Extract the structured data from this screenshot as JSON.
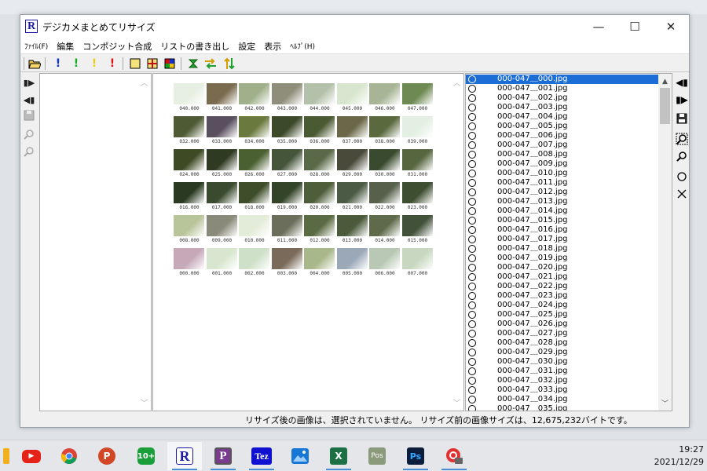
{
  "window": {
    "title": "デジカメまとめてリサイズ",
    "logo": "R"
  },
  "menu": {
    "file": "ﾌｧｲﾙ(F)",
    "edit": "編集",
    "composite": "コンポジット合成",
    "list_export": "リストの書き出し",
    "settings": "設定",
    "view": "表示",
    "help": "ﾍﾙﾌﾟ(H)"
  },
  "thumbnails": {
    "rows": [
      {
        "captions": [
          "040.000",
          "041.000",
          "042.000",
          "043.000",
          "044.000",
          "045.000",
          "046.000",
          "047.000"
        ],
        "colors": [
          "#e6efe2",
          "#7a6a4e",
          "#9fb08a",
          "#8f8e7a",
          "#b4c1aa",
          "#d9e6cf",
          "#a7b596",
          "#6e8a52"
        ]
      },
      {
        "captions": [
          "032.000",
          "033.000",
          "034.000",
          "035.000",
          "036.000",
          "037.000",
          "038.000",
          "039.000"
        ],
        "colors": [
          "#4d5a33",
          "#5a4f5e",
          "#6a7a3e",
          "#3d4a2a",
          "#4a5a32",
          "#6a6848",
          "#5a6a3e",
          "#e3efe3"
        ]
      },
      {
        "captions": [
          "024.000",
          "025.000",
          "026.000",
          "027.000",
          "028.000",
          "029.000",
          "030.000",
          "031.000"
        ],
        "colors": [
          "#3e4a24",
          "#2f3a22",
          "#4a6030",
          "#45553a",
          "#5a6a48",
          "#4a4a3a",
          "#3a4a2e",
          "#56663e"
        ]
      },
      {
        "captions": [
          "016.000",
          "017.000",
          "018.000",
          "019.000",
          "020.000",
          "021.000",
          "022.000",
          "023.000"
        ],
        "colors": [
          "#2a3a22",
          "#3a4a2e",
          "#3e4e2a",
          "#344428",
          "#4e5e3a",
          "#4a5a44",
          "#56604a",
          "#3e4e30"
        ]
      },
      {
        "captions": [
          "008.000",
          "009.000",
          "010.000",
          "011.000",
          "012.000",
          "013.000",
          "014.000",
          "015.000"
        ],
        "colors": [
          "#b8c49a",
          "#8a8a7a",
          "#e2ecd8",
          "#6a6e5a",
          "#5a6a42",
          "#4a5a3a",
          "#5e6a4a",
          "#42523a"
        ]
      },
      {
        "captions": [
          "000.000",
          "001.000",
          "002.000",
          "003.000",
          "004.000",
          "005.000",
          "006.000",
          "007.000"
        ],
        "colors": [
          "#c6a8b8",
          "#d9e6cf",
          "#cfe0c8",
          "#7a6a5a",
          "#a8b88a",
          "#9aa8b8",
          "#b8c8b4",
          "#c8d8c0"
        ]
      }
    ]
  },
  "file_list": {
    "items": [
      "000-047＿000.jpg",
      "000-047＿001.jpg",
      "000-047＿002.jpg",
      "000-047＿003.jpg",
      "000-047＿004.jpg",
      "000-047＿005.jpg",
      "000-047＿006.jpg",
      "000-047＿007.jpg",
      "000-047＿008.jpg",
      "000-047＿009.jpg",
      "000-047＿010.jpg",
      "000-047＿011.jpg",
      "000-047＿012.jpg",
      "000-047＿013.jpg",
      "000-047＿014.jpg",
      "000-047＿015.jpg",
      "000-047＿016.jpg",
      "000-047＿017.jpg",
      "000-047＿018.jpg",
      "000-047＿019.jpg",
      "000-047＿020.jpg",
      "000-047＿021.jpg",
      "000-047＿022.jpg",
      "000-047＿023.jpg",
      "000-047＿024.jpg",
      "000-047＿025.jpg",
      "000-047＿026.jpg",
      "000-047＿027.jpg",
      "000-047＿028.jpg",
      "000-047＿029.jpg",
      "000-047＿030.jpg",
      "000-047＿031.jpg",
      "000-047＿032.jpg",
      "000-047＿033.jpg",
      "000-047＿034.jpg",
      "000-047＿035.jpg"
    ],
    "selected_index": 0
  },
  "status": {
    "text": "リサイズ後の画像は、選択されていません。 リサイズ前の画像サイズは、12,675,232バイトです。"
  },
  "taskbar": {
    "apps": [
      "youtube",
      "chrome",
      "powerpoint",
      "calendar",
      "resize-app",
      "p-app",
      "tez-app",
      "photos",
      "excel",
      "pos-app",
      "photoshop",
      "camera-app"
    ],
    "clock_time": "19:27",
    "clock_date": "2021/12/29"
  },
  "colors": {
    "selection": "#1c6ed6",
    "accent": "#1a1aa6"
  }
}
